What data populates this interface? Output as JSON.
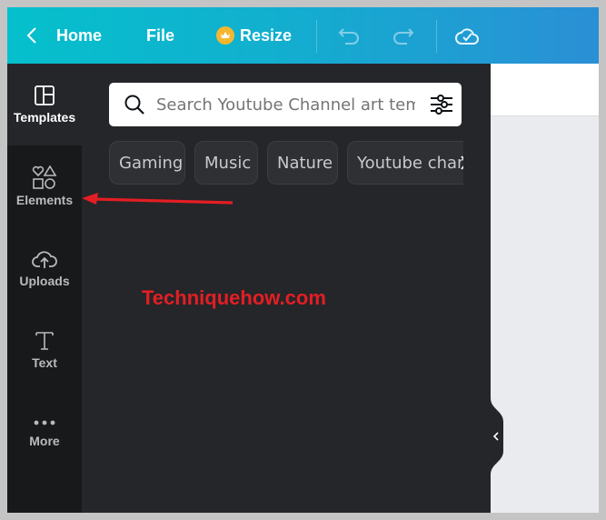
{
  "topbar": {
    "back_label": "Home",
    "file_label": "File",
    "resize_label": "Resize",
    "icons": [
      "chevron-left-icon",
      "crown-icon",
      "undo-icon",
      "redo-icon",
      "cloud-check-icon"
    ]
  },
  "sidebar": {
    "items": [
      {
        "label": "Templates",
        "icon": "templates-icon"
      },
      {
        "label": "Elements",
        "icon": "elements-icon"
      },
      {
        "label": "Uploads",
        "icon": "upload-cloud-icon"
      },
      {
        "label": "Text",
        "icon": "text-icon"
      },
      {
        "label": "More",
        "icon": "more-dots-icon"
      }
    ]
  },
  "panel": {
    "search_placeholder": "Search Youtube Channel art temp",
    "chips": [
      "Gaming",
      "Music",
      "Nature",
      "Youtube char"
    ]
  },
  "annotation": {
    "watermark": "Techniquehow.com",
    "arrow_color": "#e31e24"
  }
}
